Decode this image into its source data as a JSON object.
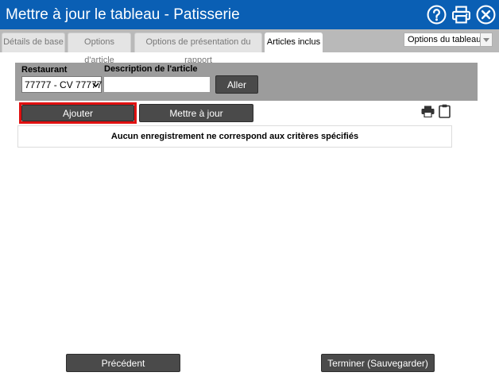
{
  "window": {
    "title": "Mettre à jour le tableau - Patisserie"
  },
  "title_icons": [
    "help-icon",
    "print-icon",
    "close-icon"
  ],
  "tabs": [
    {
      "label": "Détails de base",
      "active": false
    },
    {
      "label": "Options d'article",
      "active": false
    },
    {
      "label": "Options de présentation du rapport",
      "active": false
    },
    {
      "label": "Articles inclus",
      "active": true
    }
  ],
  "table_options": {
    "label": "Options du tableau"
  },
  "filters": {
    "restaurant_label": "Restaurant",
    "restaurant_value": "77777 - CV 77777",
    "description_label": "Description de l'article",
    "description_value": "",
    "go_label": "Aller"
  },
  "actions": {
    "add_label": "Ajouter",
    "update_label": "Mettre à jour"
  },
  "results": {
    "empty_message": "Aucun enregistrement ne correspond aux critères spécifiés"
  },
  "footer": {
    "previous_label": "Précédent",
    "finish_label": "Terminer (Sauvegarder)"
  },
  "colors": {
    "titlebar": "#0a5fb4",
    "button": "#4a4a4a",
    "highlight": "#e01010"
  }
}
